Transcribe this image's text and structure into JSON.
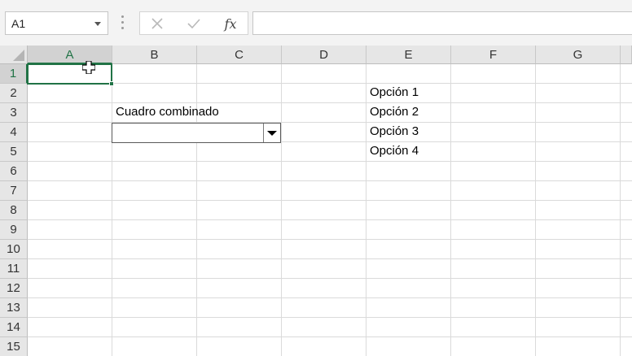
{
  "formula_bar": {
    "name_box": "A1",
    "fx_label": "fx",
    "formula_value": ""
  },
  "columns": [
    "A",
    "B",
    "C",
    "D",
    "E",
    "F",
    "G"
  ],
  "rows": [
    "1",
    "2",
    "3",
    "4",
    "5",
    "6",
    "7",
    "8",
    "9",
    "10",
    "11",
    "12",
    "13",
    "14",
    "15"
  ],
  "selected_cell": "A1",
  "cells": {
    "B3": "Cuadro combinado",
    "E2": "Opción 1",
    "E3": "Opción 2",
    "E4": "Opción 3",
    "E5": "Opción 4"
  },
  "combo_box": {
    "cell": "B4",
    "value": ""
  },
  "colors": {
    "accent": "#217346",
    "header_bg": "#e6e6e6",
    "gridline": "#dadada"
  },
  "icons": {
    "cancel": "close-icon",
    "enter": "check-icon",
    "function": "fx-icon",
    "cursor": "cell-select-cursor-icon"
  }
}
